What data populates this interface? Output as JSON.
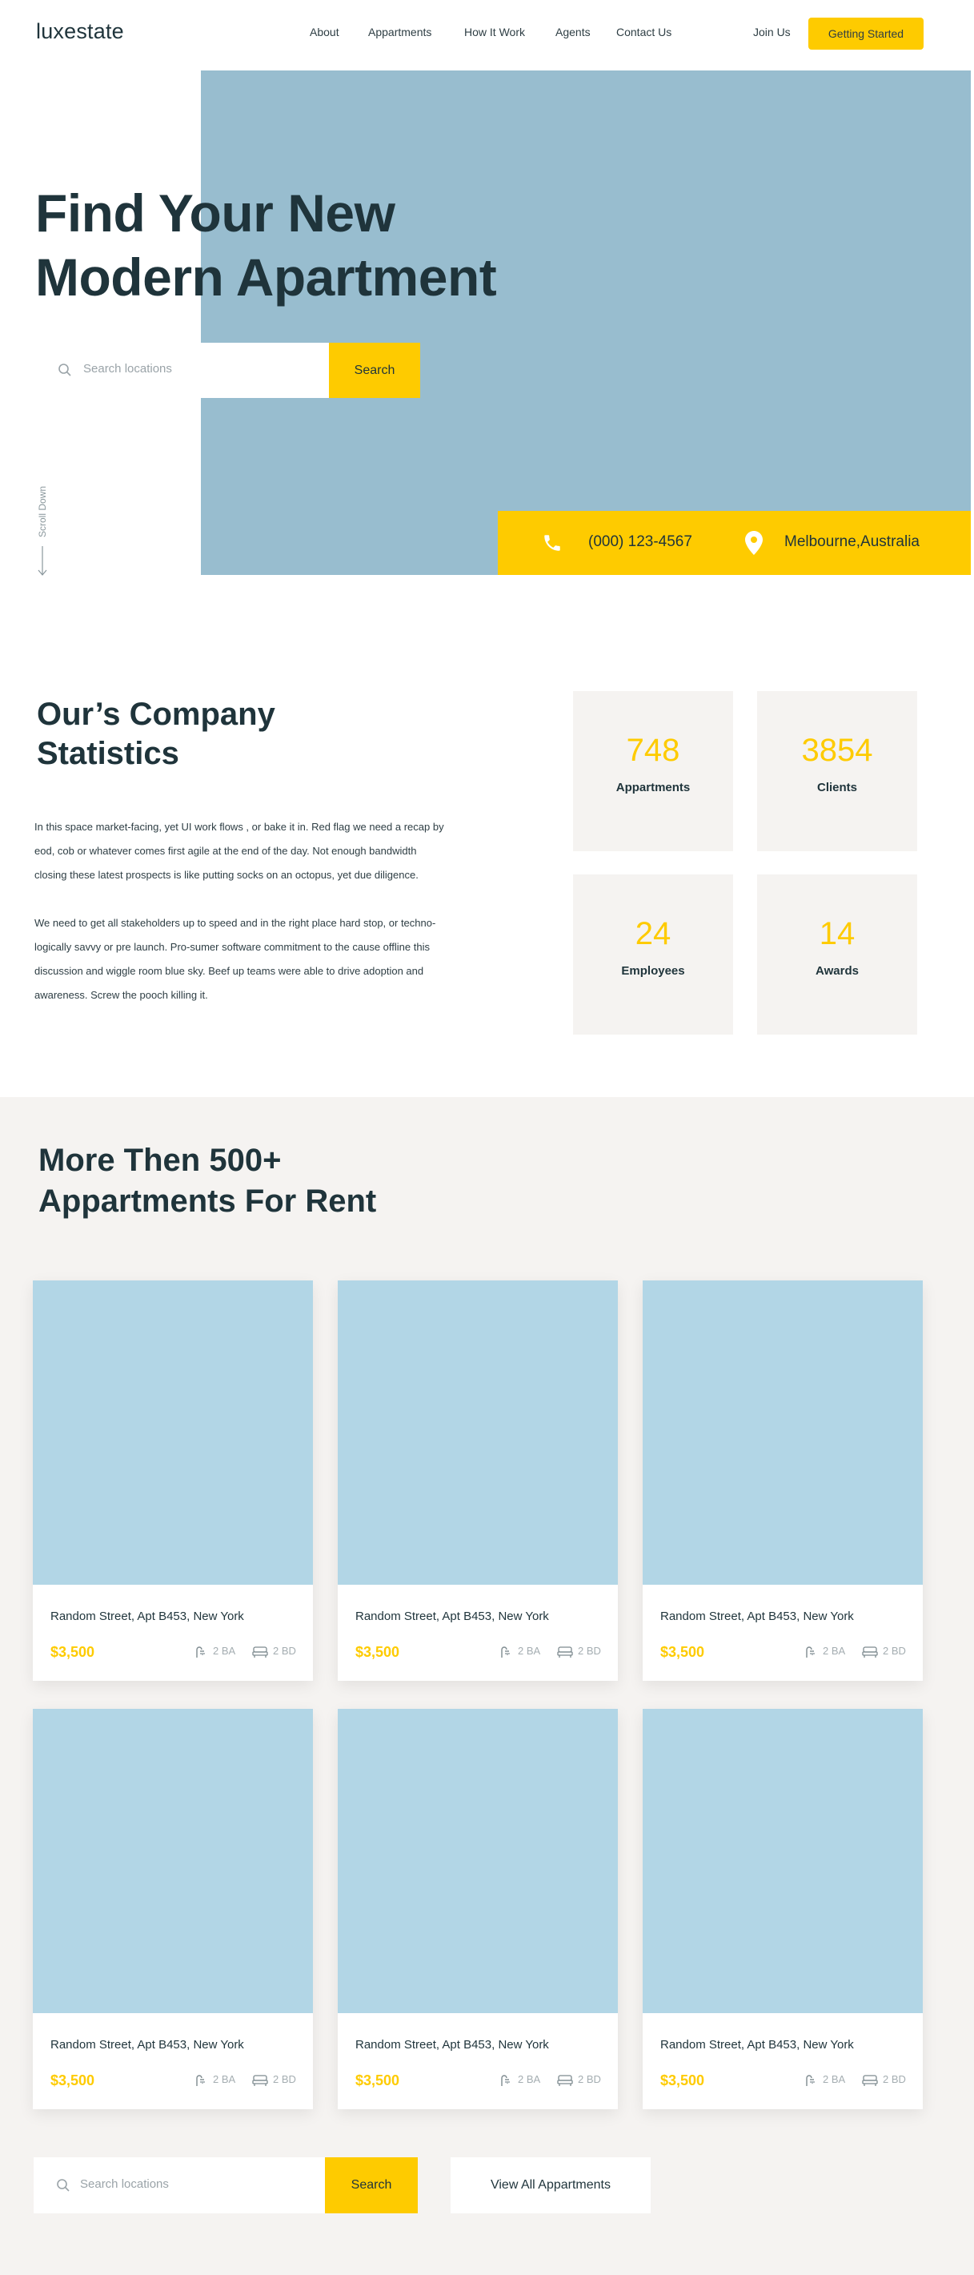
{
  "nav": {
    "logo": "luxestate",
    "menu": [
      "About",
      "Appartments",
      "How It Work",
      "Agents",
      "Contact Us"
    ],
    "join": "Join Us",
    "cta": "Getting Started"
  },
  "hero": {
    "title_line1": "Find Your New",
    "title_line2": "Modern Apartment",
    "search_placeholder": "Search locations",
    "search_button": "Search",
    "scroll_label": "Scroll Down",
    "phone": "(000) 123-4567",
    "location": "Melbourne,Australia"
  },
  "stats": {
    "title_line1": "Our’s Company",
    "title_line2": "Statistics",
    "para1_lines": [
      "In this space market-facing, yet UI work flows , or bake it in. Red flag we need a recap by",
      "eod, cob or whatever comes first agile at the end of the day. Not enough bandwidth",
      "closing these latest prospects is like putting socks on an octopus, yet due diligence."
    ],
    "para2_lines": [
      "We need to get all stakeholders up to speed and in the right place hard stop, or techno-",
      "logically savvy or pre launch. Pro-sumer software commitment to the cause offline this",
      "discussion and wiggle room blue sky. Beef up teams were able to drive adoption and",
      "awareness. Screw the pooch killing it."
    ],
    "cards": [
      {
        "num": "748",
        "label": "Appartments"
      },
      {
        "num": "3854",
        "label": "Clients"
      },
      {
        "num": "24",
        "label": "Employees"
      },
      {
        "num": "14",
        "label": "Awards"
      }
    ]
  },
  "listings": {
    "title_line1": "More Then 500+",
    "title_line2": "Appartments For Rent",
    "cards": [
      {
        "address": "Random Street, Apt B453, New York",
        "price": "$3,500",
        "ba": "2 BA",
        "bd": "2 BD"
      },
      {
        "address": "Random Street, Apt B453, New York",
        "price": "$3,500",
        "ba": "2 BA",
        "bd": "2 BD"
      },
      {
        "address": "Random Street, Apt B453, New York",
        "price": "$3,500",
        "ba": "2 BA",
        "bd": "2 BD"
      },
      {
        "address": "Random Street, Apt B453, New York",
        "price": "$3,500",
        "ba": "2 BA",
        "bd": "2 BD"
      },
      {
        "address": "Random Street, Apt B453, New York",
        "price": "$3,500",
        "ba": "2 BA",
        "bd": "2 BD"
      },
      {
        "address": "Random Street, Apt B453, New York",
        "price": "$3,500",
        "ba": "2 BA",
        "bd": "2 BD"
      }
    ],
    "search_placeholder": "Search locations",
    "search_button": "Search",
    "view_all": "View All Appartments"
  },
  "colors": {
    "accent": "#fecb00",
    "hero_image": "#98bdcf",
    "card_image": "#b2d6e6",
    "section_bg": "#f5f3f1",
    "text_dark": "#1f343b"
  },
  "icons": [
    "search-icon",
    "phone-icon",
    "location-pin-icon",
    "arrow-down-icon",
    "bath-icon",
    "bed-icon"
  ]
}
